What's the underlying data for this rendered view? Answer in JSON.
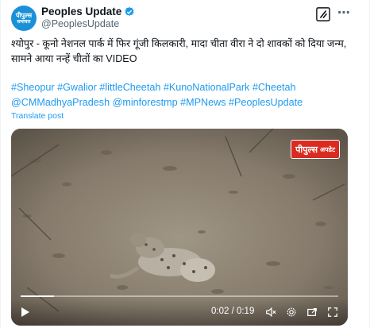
{
  "author": {
    "avatar_line1": "पीपुल्स",
    "avatar_line2": "समाचार",
    "name": "Peoples Update",
    "handle": "@PeoplesUpdate"
  },
  "tweet": {
    "text": "श्योपुर - कूनो नेशनल पार्क में फिर गूंजी किलकारी, मादा चीता वीरा ने दो शावकों को दिया जन्म, सामने आया नन्हें चीतों का VIDEO",
    "hashtags": "#Sheopur #Gwalior #littleCheetah #KunoNationalPark #Cheetah @CMMadhyaPradesh @minforestmp #MPNews #PeoplesUpdate",
    "translate_label": "Translate post"
  },
  "video": {
    "watermark_main": "पीपुल्स",
    "watermark_sub": "अपडेट",
    "time": "0:02 / 0:19",
    "progress": 0.105
  },
  "colors": {
    "accent": "#1d9bf0",
    "logo_red": "#d92b20",
    "avatar_blue": "#1a90d9"
  },
  "icons": [
    "verified-badge-icon",
    "grok-icon",
    "more-icon",
    "play-icon",
    "volume-mute-icon",
    "settings-icon",
    "fullscreen-exit-icon",
    "fullscreen-icon"
  ]
}
